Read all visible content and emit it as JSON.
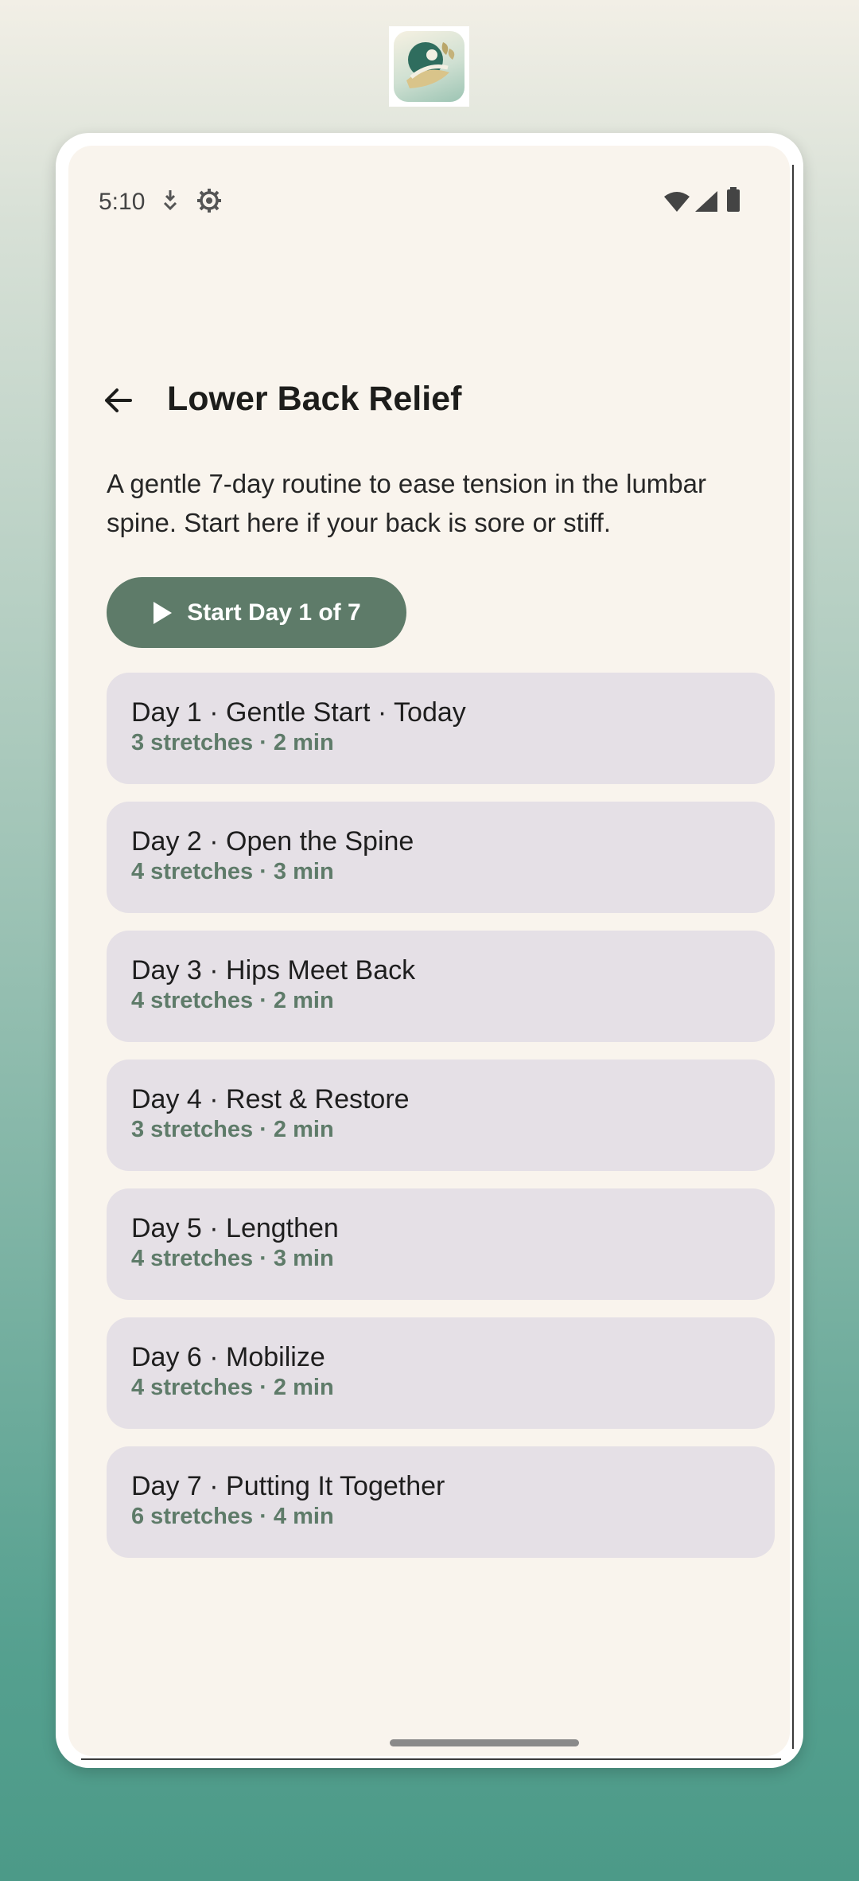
{
  "status_bar": {
    "time": "5:10",
    "left_icons": [
      "download-icon",
      "settings-gear-icon"
    ],
    "right_icons": [
      "wifi-icon",
      "cell-signal-icon",
      "battery-icon"
    ]
  },
  "header": {
    "back_icon": "arrow-back-icon",
    "title": "Lower Back Relief"
  },
  "description": "A gentle 7-day routine to ease tension in the lumbar spine. Start here if your back is sore or stiff.",
  "start_button": {
    "icon": "play-icon",
    "label": "Start Day 1 of 7"
  },
  "days": [
    {
      "title": "Day 1 · Gentle Start · Today",
      "subtitle": "3 stretches · 2 min"
    },
    {
      "title": "Day 2 · Open the Spine",
      "subtitle": "4 stretches · 3 min"
    },
    {
      "title": "Day 3 · Hips Meet Back",
      "subtitle": "4 stretches · 2 min"
    },
    {
      "title": "Day 4 · Rest & Restore",
      "subtitle": "3 stretches · 2 min"
    },
    {
      "title": "Day 5 · Lengthen",
      "subtitle": "4 stretches · 3 min"
    },
    {
      "title": "Day 6 · Mobilize",
      "subtitle": "4 stretches · 2 min"
    },
    {
      "title": "Day 7 · Putting It Together",
      "subtitle": "6 stretches · 4 min"
    }
  ],
  "colors": {
    "accent": "#5e7b69",
    "card_bg": "#e5e0e6",
    "screen_bg": "#f9f4ed"
  }
}
